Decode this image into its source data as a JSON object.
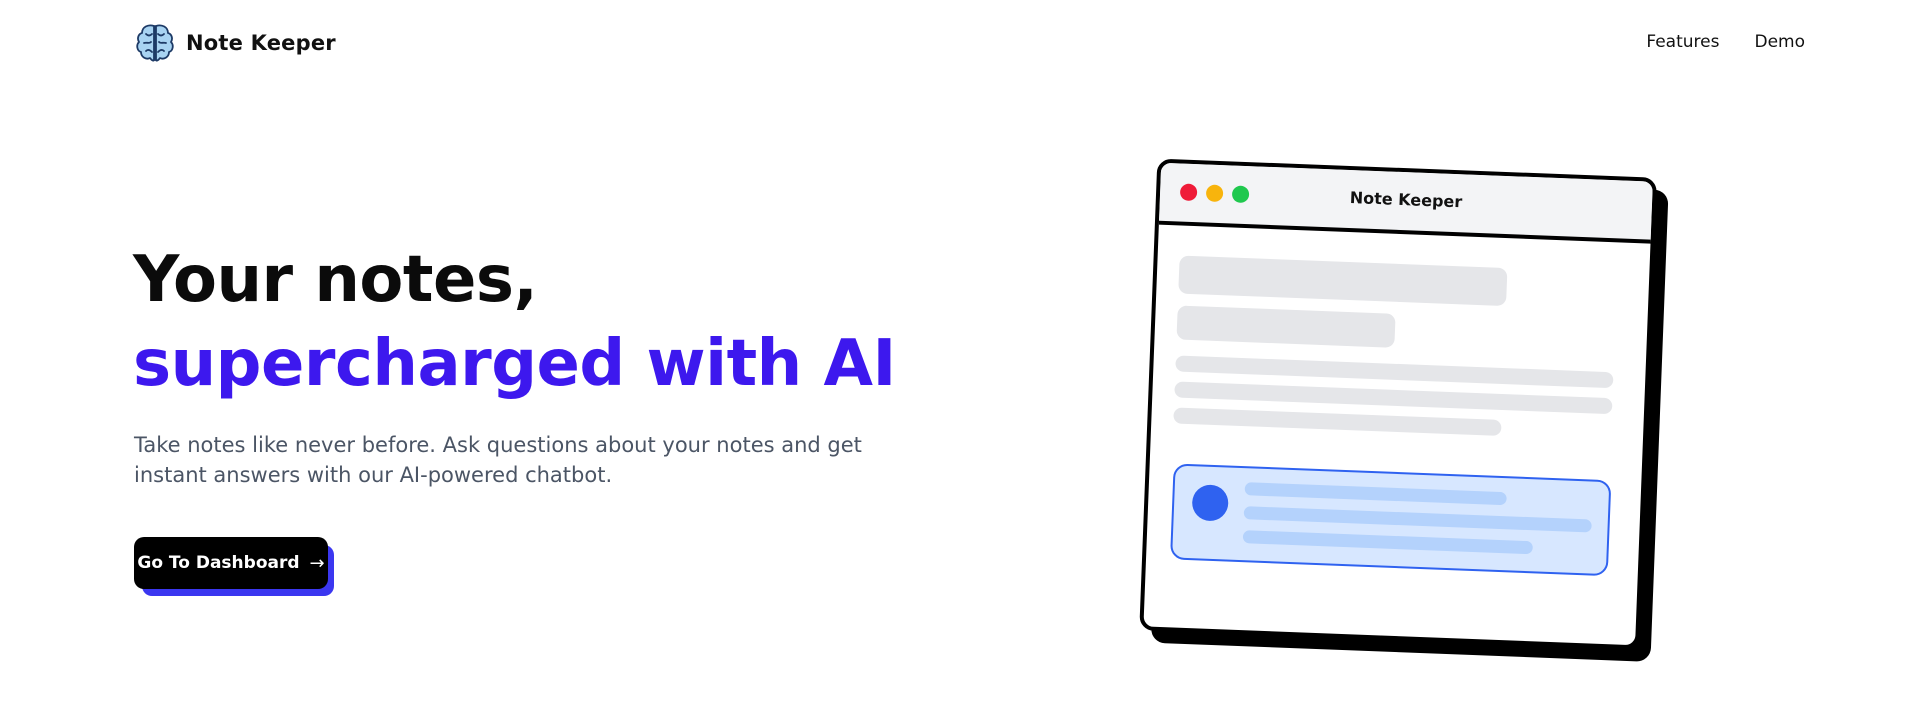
{
  "brand": {
    "name": "Note Keeper",
    "icon": "brain-icon"
  },
  "nav": {
    "links": [
      {
        "label": "Features"
      },
      {
        "label": "Demo"
      }
    ]
  },
  "hero": {
    "title_line1": "Your notes,",
    "title_line2": "supercharged with AI",
    "subtitle": "Take notes like never before. Ask questions about your notes and get instant answers with our AI-powered chatbot.",
    "cta_label": "Go To Dashboard",
    "cta_arrow": "→"
  },
  "mockup": {
    "window_title": "Note Keeper"
  },
  "colors": {
    "accent": "#3d18ee",
    "cta_shadow": "#3b37f0",
    "text_muted": "#4b5565",
    "chat_blue": "#2f62f0",
    "chat_bg": "#d7e7ff",
    "dot_red": "#ef1b38",
    "dot_yellow": "#f8b40c",
    "dot_green": "#1fc84e"
  }
}
